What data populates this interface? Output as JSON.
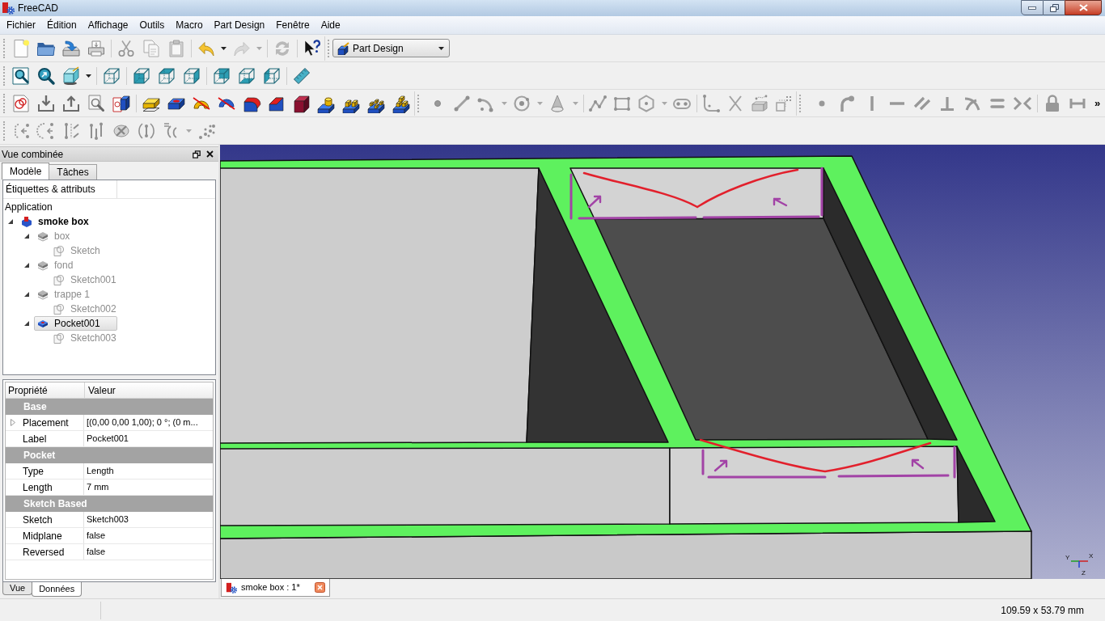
{
  "window": {
    "title": "FreeCAD"
  },
  "menu": [
    "Fichier",
    "Édition",
    "Affichage",
    "Outils",
    "Macro",
    "Part Design",
    "Fenêtre",
    "Aide"
  ],
  "toolbars": [
    {
      "buttons": [
        {
          "disabled": false
        },
        {
          "disabled": false
        },
        {
          "disabled": false
        },
        {
          "disabled": false
        },
        {
          "disabled": true
        },
        {
          "disabled": true
        },
        {
          "disabled": true
        },
        {
          "disabled": false
        },
        {
          "disabled": true
        },
        {
          "disabled": true
        },
        {
          "disabled": false
        }
      ]
    },
    {
      "buttons": [
        {
          "disabled": false
        },
        {
          "disabled": false
        },
        {
          "disabled": false
        },
        {
          "disabled": false
        },
        {
          "disabled": false
        },
        {
          "disabled": false
        },
        {
          "disabled": false
        },
        {
          "disabled": false
        },
        {
          "disabled": false
        },
        {
          "disabled": false
        },
        {
          "disabled": false
        }
      ]
    },
    {
      "buttons": [
        {
          "disabled": false
        },
        {
          "disabled": false
        },
        {
          "disabled": false
        },
        {
          "disabled": false
        },
        {
          "disabled": false
        },
        {
          "disabled": false
        },
        {
          "disabled": false
        },
        {
          "disabled": false
        },
        {
          "disabled": false
        },
        {
          "disabled": false
        },
        {
          "disabled": false
        },
        {
          "disabled": false
        },
        {
          "disabled": false
        },
        {
          "disabled": false
        },
        {
          "disabled": false
        },
        {
          "disabled": false
        }
      ]
    },
    {
      "buttons": [
        {
          "disabled": true
        },
        {
          "disabled": true
        },
        {
          "disabled": true
        },
        {
          "disabled": true
        },
        {
          "disabled": true
        },
        {
          "disabled": true
        },
        {
          "disabled": true
        },
        {
          "disabled": true
        },
        {
          "disabled": true
        },
        {
          "disabled": true
        },
        {
          "disabled": true
        },
        {
          "disabled": true
        },
        {
          "disabled": true
        }
      ]
    },
    {
      "buttons": [
        {
          "disabled": true
        },
        {
          "disabled": true
        },
        {
          "disabled": true
        },
        {
          "disabled": true
        },
        {
          "disabled": true
        },
        {
          "disabled": true
        },
        {
          "disabled": true
        },
        {
          "disabled": true
        },
        {
          "disabled": true
        },
        {
          "disabled": true
        },
        {
          "disabled": true
        }
      ],
      "overflow": "»"
    },
    {
      "buttons": [
        {
          "disabled": true
        },
        {
          "disabled": true
        },
        {
          "disabled": true
        },
        {
          "disabled": true
        },
        {
          "disabled": true
        },
        {
          "disabled": true
        },
        {
          "disabled": true
        },
        {
          "disabled": true
        }
      ]
    }
  ],
  "workbench_selector": {
    "value": "Part Design"
  },
  "combo_view": {
    "title": "Vue combinée",
    "tabs": [
      {
        "label": "Modèle",
        "selected": true
      },
      {
        "label": "Tâches",
        "selected": false
      }
    ],
    "tree": {
      "header": "Étiquettes & attributs",
      "root": "Application",
      "items": [
        {
          "label": "smoke box",
          "kind": "document",
          "visible": true,
          "selected": false,
          "expanded": true,
          "children": [
            {
              "label": "box",
              "kind": "pad",
              "visible": false,
              "selected": false,
              "expanded": true,
              "children": [
                {
                  "label": "Sketch",
                  "kind": "sketch",
                  "visible": false,
                  "selected": false
                }
              ]
            },
            {
              "label": "fond",
              "kind": "pad",
              "visible": false,
              "selected": false,
              "expanded": true,
              "children": [
                {
                  "label": "Sketch001",
                  "kind": "sketch",
                  "visible": false,
                  "selected": false
                }
              ]
            },
            {
              "label": "trappe 1",
              "kind": "pad",
              "visible": false,
              "selected": false,
              "expanded": true,
              "children": [
                {
                  "label": "Sketch002",
                  "kind": "sketch",
                  "visible": false,
                  "selected": false
                }
              ]
            },
            {
              "label": "Pocket001",
              "kind": "pocket",
              "visible": true,
              "selected": true,
              "expanded": true,
              "children": [
                {
                  "label": "Sketch003",
                  "kind": "sketch",
                  "visible": false,
                  "selected": false
                }
              ]
            }
          ]
        }
      ]
    },
    "properties": {
      "columns": [
        "Propriété",
        "Valeur"
      ],
      "groups": [
        {
          "name": "Base",
          "rows": [
            {
              "name": "Placement",
              "value": "[(0,00 0,00 1,00); 0 °; (0 m...",
              "expandable": true
            },
            {
              "name": "Label",
              "value": "Pocket001",
              "expandable": false
            }
          ]
        },
        {
          "name": "Pocket",
          "rows": [
            {
              "name": "Type",
              "value": "Length",
              "expandable": false
            },
            {
              "name": "Length",
              "value": "7 mm",
              "expandable": false
            }
          ]
        },
        {
          "name": "Sketch Based",
          "rows": [
            {
              "name": "Sketch",
              "value": "Sketch003",
              "expandable": false
            },
            {
              "name": "Midplane",
              "value": "false",
              "expandable": false
            },
            {
              "name": "Reversed",
              "value": "false",
              "expandable": false
            }
          ]
        }
      ]
    },
    "property_tabs": [
      {
        "label": "Vue",
        "selected": false
      },
      {
        "label": "Données",
        "selected": true
      }
    ]
  },
  "viewport": {
    "axis_labels": [
      "X",
      "Y",
      "Z"
    ]
  },
  "document_tabs": [
    {
      "label": "smoke box : 1*",
      "selected": true
    }
  ],
  "status_bar": {
    "dimensions": "109.59 x 53.79 mm"
  }
}
